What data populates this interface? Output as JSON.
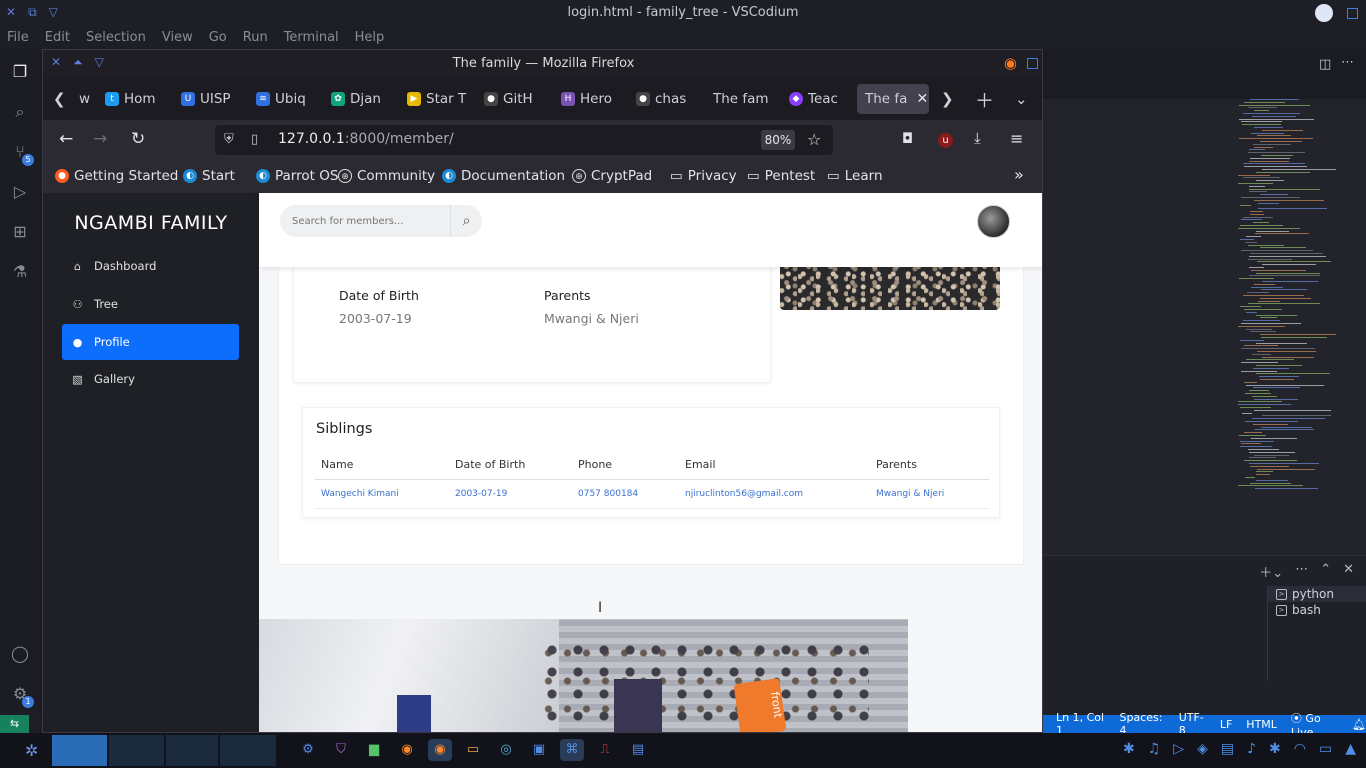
{
  "vscode": {
    "window_title": "login.html - family_tree - VSCodium",
    "menu": [
      "File",
      "Edit",
      "Selection",
      "View",
      "Go",
      "Run",
      "Terminal",
      "Help"
    ],
    "activity_badges": {
      "source_control": "5",
      "settings": "1"
    },
    "terminals": [
      "python",
      "bash"
    ],
    "status": {
      "position": "Ln 1, Col 1",
      "spaces": "Spaces: 4",
      "encoding": "UTF-8",
      "eol": "LF",
      "language": "HTML",
      "live": "Go Live"
    }
  },
  "firefox": {
    "window_title": "The family — Mozilla Firefox",
    "tabs": [
      {
        "label": "w",
        "icon": "generic-icon"
      },
      {
        "label": "Hom",
        "icon": "twitter-icon",
        "color": "#1d9bf0"
      },
      {
        "label": "UISP",
        "icon": "uisp-icon",
        "color": "#2f6fe0"
      },
      {
        "label": "Ubiq",
        "icon": "rss-icon",
        "color": "#2f6fe0"
      },
      {
        "label": "Djan",
        "icon": "chatgpt-icon",
        "color": "#10a37f"
      },
      {
        "label": "Star T",
        "icon": "star-icon",
        "color": "#e6b800"
      },
      {
        "label": "GitH",
        "icon": "github-icon",
        "color": "#444"
      },
      {
        "label": "Hero",
        "icon": "heroku-icon",
        "color": "#7952b3"
      },
      {
        "label": "chas",
        "icon": "github-icon",
        "color": "#444"
      },
      {
        "label": "The fam",
        "icon": "none"
      },
      {
        "label": "Teac",
        "icon": "teach-icon",
        "color": "#8a3ffc"
      },
      {
        "label": "The fa",
        "icon": "none",
        "active": true
      }
    ],
    "url_host": "127.0.0.1",
    "url_rest": ":8000/member/",
    "zoom": "80%",
    "bookmarks": [
      "Getting Started",
      "Start",
      "Parrot OS",
      "Community",
      "Documentation",
      "CryptPad",
      "Privacy",
      "Pentest",
      "Learn"
    ]
  },
  "site": {
    "brand": "NGAMBI FAMILY",
    "nav": [
      {
        "label": "Dashboard",
        "icon": "home-icon"
      },
      {
        "label": "Tree",
        "icon": "users-icon"
      },
      {
        "label": "Profile",
        "icon": "user-icon",
        "active": true
      },
      {
        "label": "Gallery",
        "icon": "images-icon"
      }
    ],
    "search_placeholder": "Search for members...",
    "profile": {
      "dob_label": "Date of Birth",
      "dob_value": "2003-07-19",
      "parents_label": "Parents",
      "parents_value": "Mwangi & Njeri"
    },
    "siblings": {
      "title": "Siblings",
      "columns": [
        "Name",
        "Date of Birth",
        "Phone",
        "Email",
        "Parents"
      ],
      "rows": [
        [
          "Wangechi Kimani",
          "2003-07-19",
          "0757 800184",
          "njiruclinton56@gmail.com",
          "Mwangi & Njeri"
        ]
      ]
    },
    "photo_banner_text": "front"
  }
}
